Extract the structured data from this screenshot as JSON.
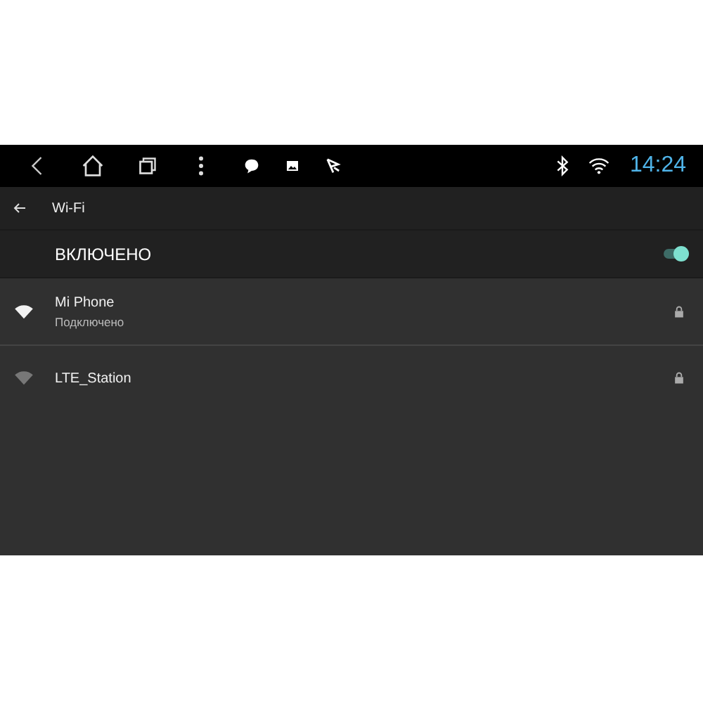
{
  "status_bar": {
    "time": "14:24"
  },
  "header": {
    "title": "Wi-Fi"
  },
  "master_switch": {
    "label": "ВКЛЮЧЕНО",
    "on": true
  },
  "networks": [
    {
      "name": "Mi Phone",
      "status": "Подключено",
      "connected": true,
      "secured": true
    },
    {
      "name": "LTE_Station",
      "connected": false,
      "secured": true
    }
  ]
}
